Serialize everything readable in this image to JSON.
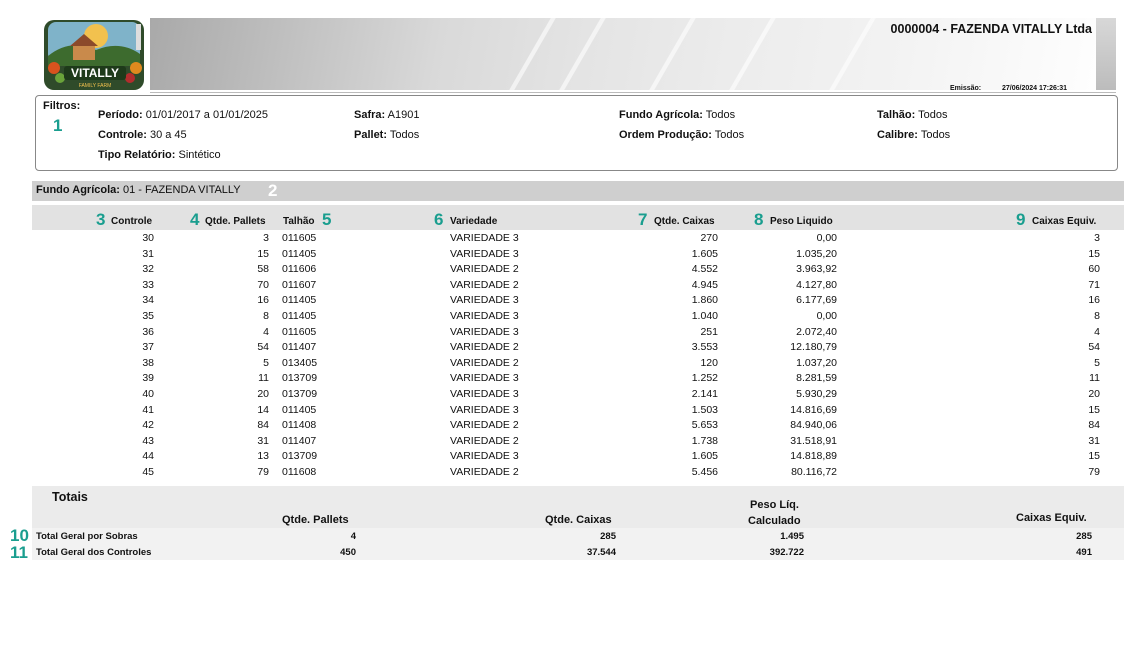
{
  "header": {
    "company_name": "0000004 - FAZENDA VITALLY Ltda",
    "emissao_label": "Emissão:",
    "emissao_value": "27/06/2024 17:26:31",
    "logo_text": "VITALLY",
    "logo_subtext": "FAMILY FARM"
  },
  "filters": {
    "title": "Filtros:",
    "periodo_label": "Período:",
    "periodo_value": "01/01/2017 a 01/01/2025",
    "controle_label": "Controle:",
    "controle_value": "30 a 45",
    "tipo_label": "Tipo Relatório:",
    "tipo_value": "Sintético",
    "safra_label": "Safra:",
    "safra_value": "A1901",
    "pallet_label": "Pallet:",
    "pallet_value": "Todos",
    "fundo_label": "Fundo Agrícola:",
    "fundo_value": "Todos",
    "ordem_label": "Ordem Produção:",
    "ordem_value": "Todos",
    "talhao_label": "Talhão:",
    "talhao_value": "Todos",
    "calibre_label": "Calibre:",
    "calibre_value": "Todos"
  },
  "fund": {
    "label": "Fundo Agrícola:",
    "value": "01 - FAZENDA VITALLY"
  },
  "columns": {
    "controle": "Controle",
    "pallets": "Qtde. Pallets",
    "talhao": "Talhão",
    "variedade": "Variedade",
    "caixas": "Qtde. Caixas",
    "peso": "Peso Liquido",
    "equiv": "Caixas Equiv."
  },
  "badges": [
    "1",
    "2",
    "3",
    "4",
    "5",
    "6",
    "7",
    "8",
    "9",
    "10",
    "11"
  ],
  "rows": [
    {
      "controle": "30",
      "pallets": "3",
      "talhao": "011605",
      "variedade": "VARIEDADE 3",
      "caixas": "270",
      "peso": "0,00",
      "equiv": "3"
    },
    {
      "controle": "31",
      "pallets": "15",
      "talhao": "011405",
      "variedade": "VARIEDADE 3",
      "caixas": "1.605",
      "peso": "1.035,20",
      "equiv": "15"
    },
    {
      "controle": "32",
      "pallets": "58",
      "talhao": "011606",
      "variedade": "VARIEDADE 2",
      "caixas": "4.552",
      "peso": "3.963,92",
      "equiv": "60"
    },
    {
      "controle": "33",
      "pallets": "70",
      "talhao": "011607",
      "variedade": "VARIEDADE 2",
      "caixas": "4.945",
      "peso": "4.127,80",
      "equiv": "71"
    },
    {
      "controle": "34",
      "pallets": "16",
      "talhao": "011405",
      "variedade": "VARIEDADE 3",
      "caixas": "1.860",
      "peso": "6.177,69",
      "equiv": "16"
    },
    {
      "controle": "35",
      "pallets": "8",
      "talhao": "011405",
      "variedade": "VARIEDADE 3",
      "caixas": "1.040",
      "peso": "0,00",
      "equiv": "8"
    },
    {
      "controle": "36",
      "pallets": "4",
      "talhao": "011605",
      "variedade": "VARIEDADE 3",
      "caixas": "251",
      "peso": "2.072,40",
      "equiv": "4"
    },
    {
      "controle": "37",
      "pallets": "54",
      "talhao": "011407",
      "variedade": "VARIEDADE 2",
      "caixas": "3.553",
      "peso": "12.180,79",
      "equiv": "54"
    },
    {
      "controle": "38",
      "pallets": "5",
      "talhao": "013405",
      "variedade": "VARIEDADE 2",
      "caixas": "120",
      "peso": "1.037,20",
      "equiv": "5"
    },
    {
      "controle": "39",
      "pallets": "11",
      "talhao": "013709",
      "variedade": "VARIEDADE 3",
      "caixas": "1.252",
      "peso": "8.281,59",
      "equiv": "11"
    },
    {
      "controle": "40",
      "pallets": "20",
      "talhao": "013709",
      "variedade": "VARIEDADE 3",
      "caixas": "2.141",
      "peso": "5.930,29",
      "equiv": "20"
    },
    {
      "controle": "41",
      "pallets": "14",
      "talhao": "011405",
      "variedade": "VARIEDADE 3",
      "caixas": "1.503",
      "peso": "14.816,69",
      "equiv": "15"
    },
    {
      "controle": "42",
      "pallets": "84",
      "talhao": "011408",
      "variedade": "VARIEDADE 2",
      "caixas": "5.653",
      "peso": "84.940,06",
      "equiv": "84"
    },
    {
      "controle": "43",
      "pallets": "31",
      "talhao": "011407",
      "variedade": "VARIEDADE 2",
      "caixas": "1.738",
      "peso": "31.518,91",
      "equiv": "31"
    },
    {
      "controle": "44",
      "pallets": "13",
      "talhao": "013709",
      "variedade": "VARIEDADE 3",
      "caixas": "1.605",
      "peso": "14.818,89",
      "equiv": "15"
    },
    {
      "controle": "45",
      "pallets": "79",
      "talhao": "011608",
      "variedade": "VARIEDADE 2",
      "caixas": "5.456",
      "peso": "80.116,72",
      "equiv": "79"
    }
  ],
  "totals": {
    "title": "Totais",
    "head_pallets": "Qtde. Pallets",
    "head_caixas": "Qtde. Caixas",
    "head_peso_1": "Peso Líq.",
    "head_peso_2": "Calculado",
    "head_equiv": "Caixas Equiv.",
    "sobras": {
      "label": "Total Geral por Sobras",
      "pallets": "4",
      "caixas": "285",
      "peso": "1.495",
      "equiv": "285"
    },
    "controles": {
      "label": "Total Geral dos Controles",
      "pallets": "450",
      "caixas": "37.544",
      "peso": "392.722",
      "equiv": "491"
    }
  },
  "colors": {
    "accent_badge": "#1a9e8f",
    "fund_bar": "#cfcfcf",
    "header_bar": "#e2e2e2"
  }
}
